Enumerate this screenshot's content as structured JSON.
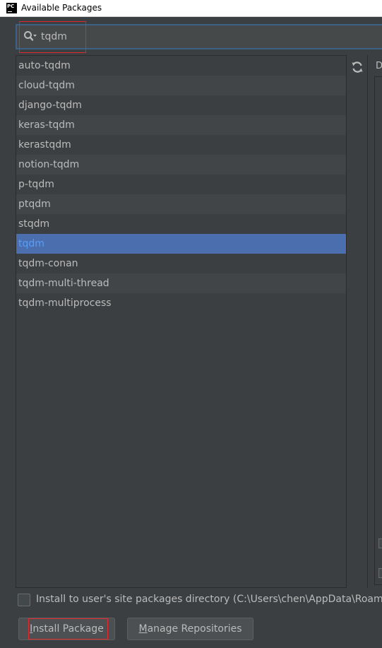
{
  "window": {
    "icon_text": "PC",
    "title": "Available Packages"
  },
  "search": {
    "value": "tqdm",
    "icon": "search-icon"
  },
  "packages": [
    "auto-tqdm",
    "cloud-tqdm",
    "django-tqdm",
    "keras-tqdm",
    "kerastqdm",
    "notion-tqdm",
    "p-tqdm",
    "ptqdm",
    "stqdm",
    "tqdm",
    "tqdm-conan",
    "tqdm-multi-thread",
    "tqdm-multiprocess"
  ],
  "selected_package": "tqdm",
  "details": {
    "label_fragment": "D"
  },
  "options": {
    "user_site_label": "Install to user's site packages directory (C:\\Users\\chen\\AppData\\Roaming",
    "user_site_checked": false
  },
  "buttons": {
    "install_mnemonic": "I",
    "install_rest": "nstall Package",
    "manage_mnemonic": "M",
    "manage_rest": "anage Repositories"
  },
  "colors": {
    "background": "#3c3f41",
    "selection": "#4b6eaf",
    "selected_text": "#589df6",
    "highlight_outline": "#e0282e",
    "focus_border": "#3d6185"
  }
}
